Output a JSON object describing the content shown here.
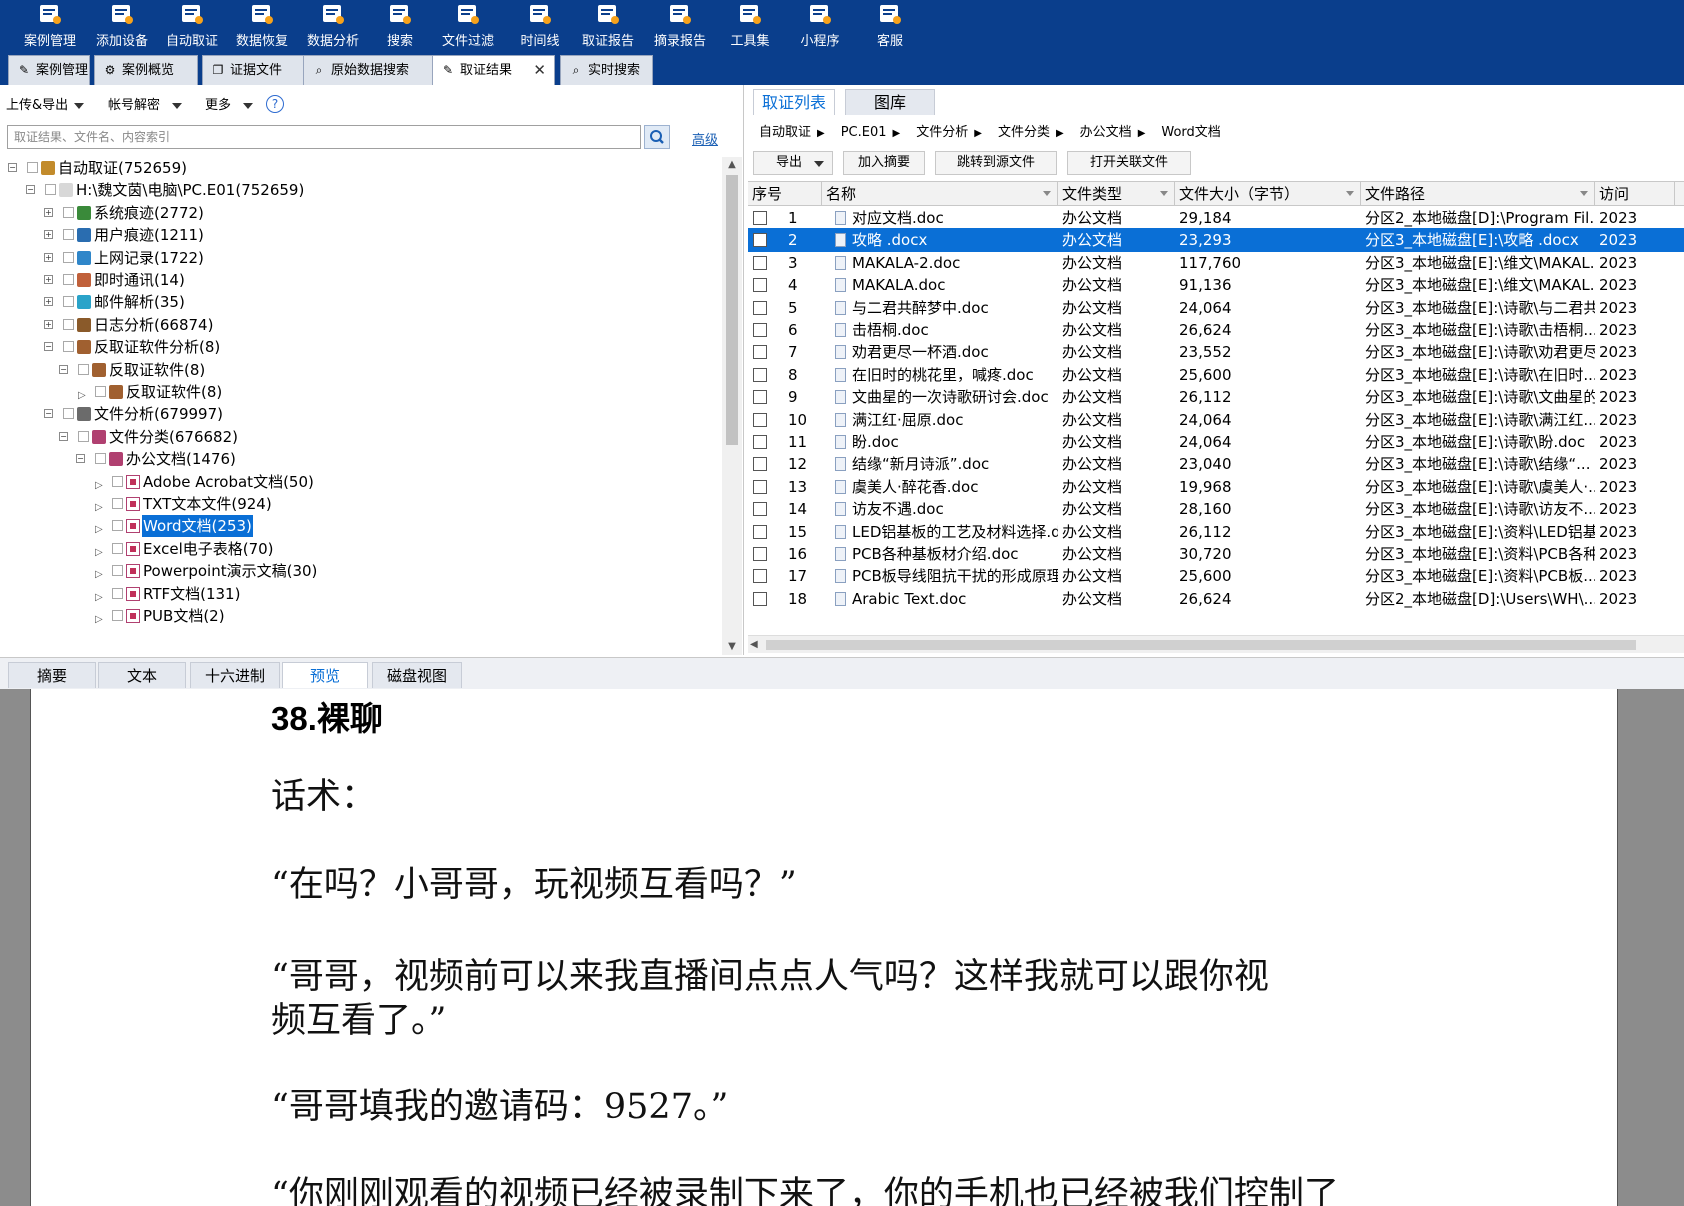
{
  "toolbar": [
    {
      "label": "案例管理",
      "icon": "case-manage-icon"
    },
    {
      "label": "添加设备",
      "icon": "add-device-icon"
    },
    {
      "label": "自动取证",
      "icon": "auto-forensics-icon"
    },
    {
      "label": "数据恢复",
      "icon": "data-recovery-icon"
    },
    {
      "label": "数据分析",
      "icon": "data-analysis-icon"
    },
    {
      "label": "搜索",
      "icon": "search-doc-icon"
    },
    {
      "label": "文件过滤",
      "icon": "file-filter-icon"
    },
    {
      "label": "时间线",
      "icon": "timeline-icon"
    },
    {
      "label": "取证报告",
      "icon": "report-icon"
    },
    {
      "label": "摘录报告",
      "icon": "excerpt-report-icon"
    },
    {
      "label": "工具集",
      "icon": "toolset-icon"
    },
    {
      "label": "小程序",
      "icon": "mini-program-icon"
    },
    {
      "label": "客服",
      "icon": "customer-service-icon"
    }
  ],
  "module_tabs": [
    {
      "label": "案例管理",
      "icon": "✎"
    },
    {
      "label": "案例概览",
      "icon": "⚙"
    },
    {
      "label": "证据文件",
      "icon": "❐"
    },
    {
      "label": "原始数据搜索",
      "icon": "⌕"
    },
    {
      "label": "取证结果",
      "icon": "✎",
      "active": true,
      "close": "✕"
    },
    {
      "label": "实时搜索",
      "icon": "⌕"
    }
  ],
  "left_toolbar": {
    "upload_export": "上传&导出",
    "account_decrypt": "帐号解密",
    "more": "更多",
    "help": "?"
  },
  "search": {
    "placeholder": "取证结果、文件名、内容索引",
    "advanced": "高级"
  },
  "tree": [
    {
      "label": "自动取证(752659)",
      "expand": "−",
      "icon": "case-icon"
    },
    {
      "label": "H:\\魏文茵\\电脑\\PC.E01(752659)",
      "expand": "−",
      "icon": "disk-image-icon"
    },
    {
      "label": "系统痕迹(2772)",
      "expand": "+",
      "icon": "system-trace-icon"
    },
    {
      "label": "用户痕迹(1211)",
      "expand": "+",
      "icon": "user-trace-icon"
    },
    {
      "label": "上网记录(1722)",
      "expand": "+",
      "icon": "web-history-icon"
    },
    {
      "label": "即时通讯(14)",
      "expand": "+",
      "icon": "im-icon"
    },
    {
      "label": "邮件解析(35)",
      "expand": "+",
      "icon": "mail-icon"
    },
    {
      "label": "日志分析(66874)",
      "expand": "+",
      "icon": "log-icon"
    },
    {
      "label": "反取证软件分析(8)",
      "expand": "−",
      "icon": "anti-forensics-icon"
    },
    {
      "label": "反取证软件(8)",
      "expand": "−",
      "icon": "anti-forensics-icon"
    },
    {
      "label": "反取证软件(8)",
      "expand": "",
      "icon": "anti-forensics-icon"
    },
    {
      "label": "文件分析(679997)",
      "expand": "−",
      "icon": "file-analysis-icon"
    },
    {
      "label": "文件分类(676682)",
      "expand": "−",
      "icon": "file-category-icon"
    },
    {
      "label": "办公文档(1476)",
      "expand": "−",
      "icon": "office-doc-icon"
    },
    {
      "label": "Adobe Acrobat文档(50)",
      "expand": "",
      "icon": "pdf-doc-icon"
    },
    {
      "label": "TXT文本文件(924)",
      "expand": "",
      "icon": "txt-doc-icon"
    },
    {
      "label": "Word文档(253)",
      "expand": "",
      "icon": "word-doc-icon",
      "selected": true
    },
    {
      "label": "Excel电子表格(70)",
      "expand": "",
      "icon": "excel-doc-icon"
    },
    {
      "label": "Powerpoint演示文稿(30)",
      "expand": "",
      "icon": "ppt-doc-icon"
    },
    {
      "label": "RTF文档(131)",
      "expand": "",
      "icon": "rtf-doc-icon"
    },
    {
      "label": "PUB文档(2)",
      "expand": "",
      "icon": "pub-doc-icon"
    }
  ],
  "right_tabs": [
    {
      "label": "取证列表",
      "active": true
    },
    {
      "label": "图库"
    }
  ],
  "breadcrumb": [
    "自动取证",
    "PC.E01",
    "文件分析",
    "文件分类",
    "办公文档",
    "Word文档"
  ],
  "breadcrumb_sep": "▶",
  "right_buttons": {
    "export": "导出",
    "add_excerpt": "加入摘要",
    "goto_source": "跳转到源文件",
    "open_related": "打开关联文件"
  },
  "table": {
    "columns": [
      "序号",
      "名称",
      "文件类型",
      "文件大小（字节）",
      "文件路径",
      "访问"
    ],
    "rows": [
      {
        "n": "1",
        "name": "对应文档.doc",
        "type": "办公文档",
        "size": "29,184",
        "path": "分区2_本地磁盘[D]:\\Program Fil...",
        "t": "2023"
      },
      {
        "n": "2",
        "name": "攻略 .docx",
        "type": "办公文档",
        "size": "23,293",
        "path": "分区3_本地磁盘[E]:\\攻略 .docx",
        "t": "2023",
        "selected": true
      },
      {
        "n": "3",
        "name": "MAKALA-2.doc",
        "type": "办公文档",
        "size": "117,760",
        "path": "分区3_本地磁盘[E]:\\维文\\MAKAL...",
        "t": "2023"
      },
      {
        "n": "4",
        "name": "MAKALA.doc",
        "type": "办公文档",
        "size": "91,136",
        "path": "分区3_本地磁盘[E]:\\维文\\MAKAL...",
        "t": "2023"
      },
      {
        "n": "5",
        "name": "与二君共醉梦中.doc",
        "type": "办公文档",
        "size": "24,064",
        "path": "分区3_本地磁盘[E]:\\诗歌\\与二君共...",
        "t": "2023"
      },
      {
        "n": "6",
        "name": "击梧桐.doc",
        "type": "办公文档",
        "size": "26,624",
        "path": "分区3_本地磁盘[E]:\\诗歌\\击梧桐....",
        "t": "2023"
      },
      {
        "n": "7",
        "name": "劝君更尽一杯酒.doc",
        "type": "办公文档",
        "size": "23,552",
        "path": "分区3_本地磁盘[E]:\\诗歌\\劝君更尽...",
        "t": "2023"
      },
      {
        "n": "8",
        "name": "在旧时的桃花里，喊疼.doc",
        "type": "办公文档",
        "size": "25,600",
        "path": "分区3_本地磁盘[E]:\\诗歌\\在旧时...",
        "t": "2023"
      },
      {
        "n": "9",
        "name": "文曲星的一次诗歌研讨会.doc",
        "type": "办公文档",
        "size": "26,112",
        "path": "分区3_本地磁盘[E]:\\诗歌\\文曲星的...",
        "t": "2023"
      },
      {
        "n": "10",
        "name": "满江红·屈原.doc",
        "type": "办公文档",
        "size": "24,064",
        "path": "分区3_本地磁盘[E]:\\诗歌\\满江红...",
        "t": "2023"
      },
      {
        "n": "11",
        "name": "盼.doc",
        "type": "办公文档",
        "size": "24,064",
        "path": "分区3_本地磁盘[E]:\\诗歌\\盼.doc",
        "t": "2023"
      },
      {
        "n": "12",
        "name": "结缘“新月诗派”.doc",
        "type": "办公文档",
        "size": "23,040",
        "path": "分区3_本地磁盘[E]:\\诗歌\\结缘“...",
        "t": "2023"
      },
      {
        "n": "13",
        "name": "虞美人·醉花香.doc",
        "type": "办公文档",
        "size": "19,968",
        "path": "分区3_本地磁盘[E]:\\诗歌\\虞美人·...",
        "t": "2023"
      },
      {
        "n": "14",
        "name": "访友不遇.doc",
        "type": "办公文档",
        "size": "28,160",
        "path": "分区3_本地磁盘[E]:\\诗歌\\访友不...",
        "t": "2023"
      },
      {
        "n": "15",
        "name": "LED铝基板的工艺及材料选择.doc",
        "type": "办公文档",
        "size": "26,112",
        "path": "分区3_本地磁盘[E]:\\资料\\LED铝基...",
        "t": "2023"
      },
      {
        "n": "16",
        "name": "PCB各种基板材介绍.doc",
        "type": "办公文档",
        "size": "30,720",
        "path": "分区3_本地磁盘[E]:\\资料\\PCB各种...",
        "t": "2023"
      },
      {
        "n": "17",
        "name": "PCB板导线阻抗干扰的形成原理....",
        "type": "办公文档",
        "size": "25,600",
        "path": "分区3_本地磁盘[E]:\\资料\\PCB板...",
        "t": "2023"
      },
      {
        "n": "18",
        "name": "Arabic Text.doc",
        "type": "办公文档",
        "size": "26,624",
        "path": "分区2_本地磁盘[D]:\\Users\\WH\\...",
        "t": "2023"
      }
    ]
  },
  "bottom_tabs": [
    {
      "label": "摘要"
    },
    {
      "label": "文本"
    },
    {
      "label": "十六进制"
    },
    {
      "label": "预览",
      "active": true
    },
    {
      "label": "磁盘视图"
    }
  ],
  "preview": {
    "title": "38.裸聊",
    "lines": [
      "话术：",
      "“在吗？小哥哥，玩视频互看吗？”",
      "“哥哥，视频前可以来我直播间点点人气吗？这样我就可以跟你视",
      "频互看了。”",
      "“哥哥填我的邀请码：9527。”",
      "“你刚刚观看的视频已经被录制下来了，你的手机也已经被我们控制了"
    ]
  },
  "colors": {
    "ribbon": "#0a3e8c",
    "selection": "#0a6fd6",
    "accent": "#0a6fd6"
  }
}
